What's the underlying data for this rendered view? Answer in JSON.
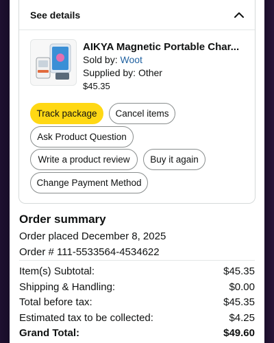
{
  "details": {
    "header_label": "See details"
  },
  "product": {
    "title": "AIKYA Magnetic Portable Char...",
    "sold_by_prefix": "Sold by: ",
    "sold_by": "Woot",
    "supplied_by": "Supplied by: Other",
    "price": "$45.35"
  },
  "actions": {
    "track": "Track package",
    "cancel": "Cancel items",
    "ask": "Ask Product Question",
    "review": "Write a product review",
    "buy_again": "Buy it again",
    "payment": "Change Payment Method"
  },
  "summary": {
    "title": "Order summary",
    "placed": "Order placed December 8, 2025",
    "order_number": "Order # 111-5533564-4534622",
    "rows": [
      {
        "label": "Item(s) Subtotal:",
        "value": "$45.35"
      },
      {
        "label": "Shipping & Handling:",
        "value": "$0.00"
      },
      {
        "label": "Total before tax:",
        "value": "$45.35"
      },
      {
        "label": "Estimated tax to be collected:",
        "value": "$4.25"
      },
      {
        "label": "Grand Total:",
        "value": "$49.60"
      }
    ]
  },
  "colors": {
    "primary_button": "#ffd814",
    "link": "#2162a1",
    "text": "#0f1111",
    "backdrop": "#120a22"
  },
  "icons": {
    "collapse": "chevron-up-icon",
    "product_image": "power-bank-product-image"
  }
}
